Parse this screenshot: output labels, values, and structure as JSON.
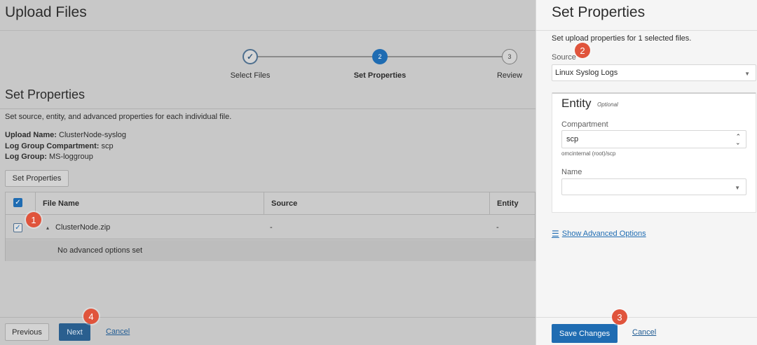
{
  "page": {
    "title": "Upload Files",
    "train": {
      "steps": [
        {
          "label": "Select Files",
          "state": "done",
          "glyph": "✓"
        },
        {
          "label": "Set Properties",
          "state": "active",
          "glyph": "2"
        },
        {
          "label": "Review",
          "state": "todo",
          "glyph": "3"
        }
      ]
    },
    "section_title": "Set Properties",
    "section_desc": "Set source, entity, and advanced properties for each individual file.",
    "info": {
      "upload_name_label": "Upload Name:",
      "upload_name_value": "ClusterNode-syslog",
      "compartment_label": "Log Group Compartment:",
      "compartment_value": "scp",
      "log_group_label": "Log Group:",
      "log_group_value": "MS-loggroup"
    },
    "set_properties_button": "Set Properties",
    "table": {
      "columns": [
        "File Name",
        "Source",
        "Entity"
      ],
      "rows": [
        {
          "file_name": "ClusterNode.zip",
          "source": "-",
          "entity": "-",
          "expander": "▴"
        }
      ],
      "detail_text": "No advanced options set"
    },
    "footer": {
      "previous_label": "Previous",
      "next_label": "Next",
      "cancel_label": "Cancel"
    }
  },
  "panel": {
    "title": "Set Properties",
    "description": "Set upload properties for 1 selected files.",
    "source_label": "Source",
    "source_value": "Linux Syslog Logs",
    "entity": {
      "title": "Entity",
      "optional_label": "Optional",
      "compartment_label": "Compartment",
      "compartment_value": "scp",
      "compartment_path": "omcinternal (root)/scp",
      "name_label": "Name",
      "name_value": ""
    },
    "advanced_link": "Show Advanced Options",
    "save_label": "Save Changes",
    "cancel_label": "Cancel"
  },
  "markers": [
    "1",
    "2",
    "3",
    "4"
  ],
  "colors": {
    "accent": "#1f6cb2",
    "marker": "#e0543c",
    "dim_overlay": "#c8c8c8",
    "panel_bg": "#f5f5f5"
  },
  "icons": {
    "check": "check-icon",
    "caret": "caret-down-icon",
    "stepper": "up-down-icon",
    "advanced": "sliders-icon",
    "expand": "triangle-expand-icon"
  }
}
